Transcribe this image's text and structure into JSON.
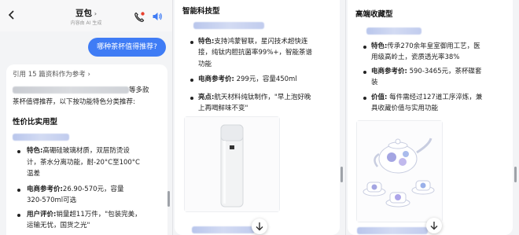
{
  "chat": {
    "title": "豆包",
    "subtitle": "内容由 AI 生成",
    "user_question": "哪种茶杯值得推荐?",
    "citation": "引用 15 篇资料作为参考",
    "intro_suffix": "等多款",
    "intro_line2": "茶杯值得推荐，以下按功能特色分类推荐:",
    "section_value": "性价比实用型",
    "feature_label": "特色:",
    "price_label": "电商参考价:",
    "review_label": "用户评价:",
    "highlight_label": "亮点:",
    "value_label": "价值:",
    "p1_feature_l1": "高硼硅玻璃材质，双层防烫设",
    "p1_feature_l2": "计，茶水分离功能，耐-20°C至100°C",
    "p1_feature_l3": "温差",
    "p1_price_l1": "26.90-570元，容量",
    "p1_price_l2": "320-570ml可选",
    "p1_review_l1": "销量超11万件，\"包装完美，",
    "p1_review_l2": "运输无忧，国货之光\""
  },
  "smart": {
    "heading": "智能科技型",
    "feature_l1": "支持鸿蒙智联，星闪技术超快连",
    "feature_l2": "接，纯钛内胆抗菌率99%+，智能茶谱",
    "feature_l3": "功能",
    "price": "299元，容量450ml",
    "highlight_l1": "航天材料纯钛制作，\"早上泡好晚",
    "highlight_l2": "上再喝鲜味不变\""
  },
  "premium": {
    "heading": "高端收藏型",
    "feature_l1": "传承270余年皇室御用工艺，医",
    "feature_l2": "用级高岭土，瓷质透光率38%",
    "price_l1": "590-3465元，茶杯碟套",
    "price_l2": "装",
    "value_l1": "每件需经过127道工序淬炼，兼",
    "value_l2": "具收藏价值与实用功能"
  },
  "colors": {
    "accent": "#3f7cf5",
    "background": "#f3f4f6",
    "card": "#ffffff",
    "text": "#1f1f1f"
  },
  "icons": [
    "back-arrow-icon",
    "phone-call-icon",
    "speaker-icon",
    "chevron-right-icon",
    "scroll-down-icon"
  ]
}
